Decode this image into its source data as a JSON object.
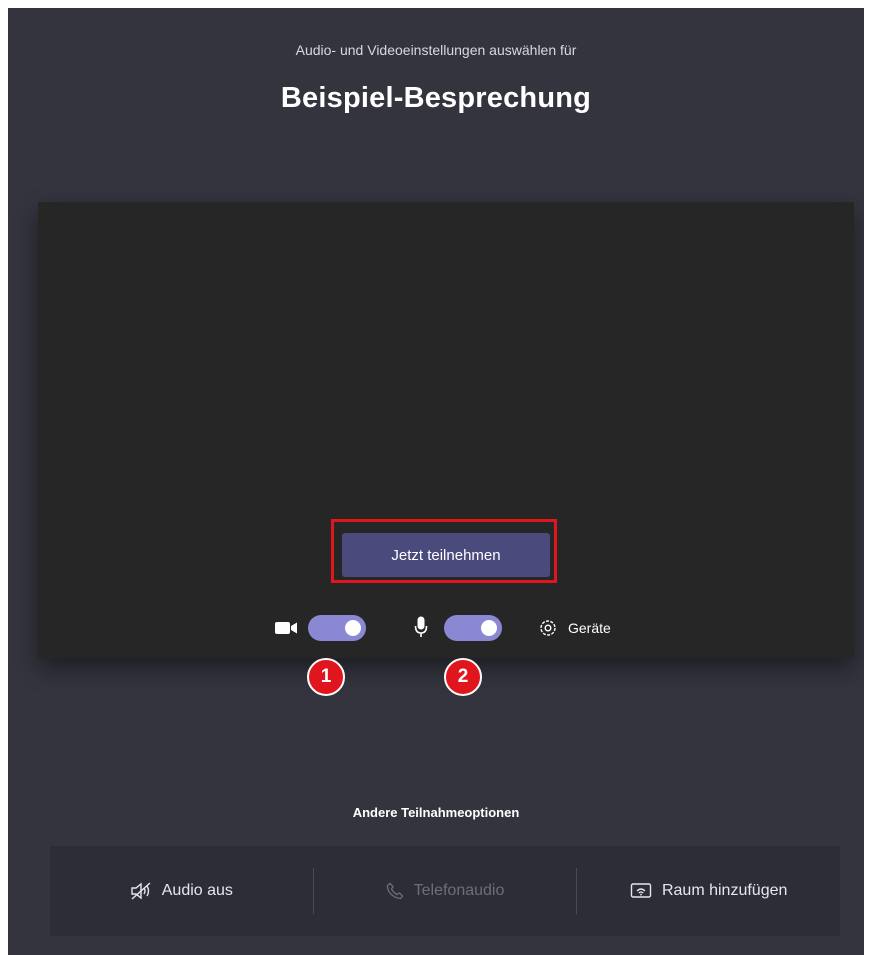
{
  "header": {
    "subtitle": "Audio- und Videoeinstellungen auswählen für",
    "meeting_title": "Beispiel-Besprechung"
  },
  "preview": {
    "join_button_label": "Jetzt teilnehmen"
  },
  "controls": {
    "camera_icon": "video-camera-icon",
    "camera_on": true,
    "mic_icon": "microphone-icon",
    "mic_on": true,
    "devices_icon": "gear-icon",
    "devices_label": "Geräte",
    "toggle_color": "#8a87d3"
  },
  "annotations": {
    "badge_1": "1",
    "badge_2": "2",
    "highlight_color": "#e0151d"
  },
  "other_options": {
    "heading": "Andere Teilnahmeoptionen",
    "items": [
      {
        "label": "Audio aus",
        "icon": "speaker-off-icon",
        "enabled": true
      },
      {
        "label": "Telefonaudio",
        "icon": "phone-icon",
        "enabled": false
      },
      {
        "label": "Raum hinzufügen",
        "icon": "cast-screen-icon",
        "enabled": true
      }
    ]
  },
  "colors": {
    "background": "#34343f",
    "preview_bg": "#262626",
    "join_button": "#4b4a7d"
  }
}
